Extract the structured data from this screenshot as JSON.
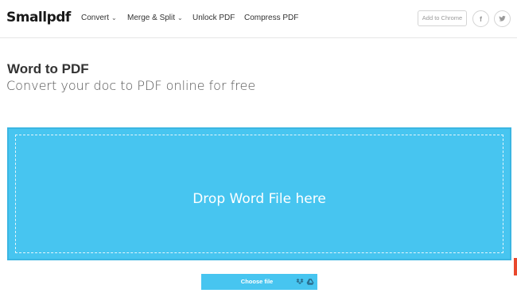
{
  "header": {
    "logo": "Smallpdf",
    "nav": [
      {
        "label": "Convert",
        "has_dropdown": true
      },
      {
        "label": "Merge & Split",
        "has_dropdown": true
      },
      {
        "label": "Unlock PDF",
        "has_dropdown": false
      },
      {
        "label": "Compress PDF",
        "has_dropdown": false
      }
    ],
    "add_to_chrome": "Add to Chrome",
    "social": [
      {
        "icon": "facebook-icon",
        "glyph": "f"
      },
      {
        "icon": "twitter-icon"
      }
    ]
  },
  "main": {
    "title": "Word to PDF",
    "subtitle": "Convert your doc to PDF online for free",
    "dropzone_text": "Drop Word File here",
    "choose_file_label": "Choose file",
    "choose_file_icons": [
      "dropbox-icon",
      "google-drive-icon"
    ]
  },
  "colors": {
    "accent": "#47c5f0",
    "accent_border": "#3bb6e2",
    "side_tab": "#e9482d"
  }
}
